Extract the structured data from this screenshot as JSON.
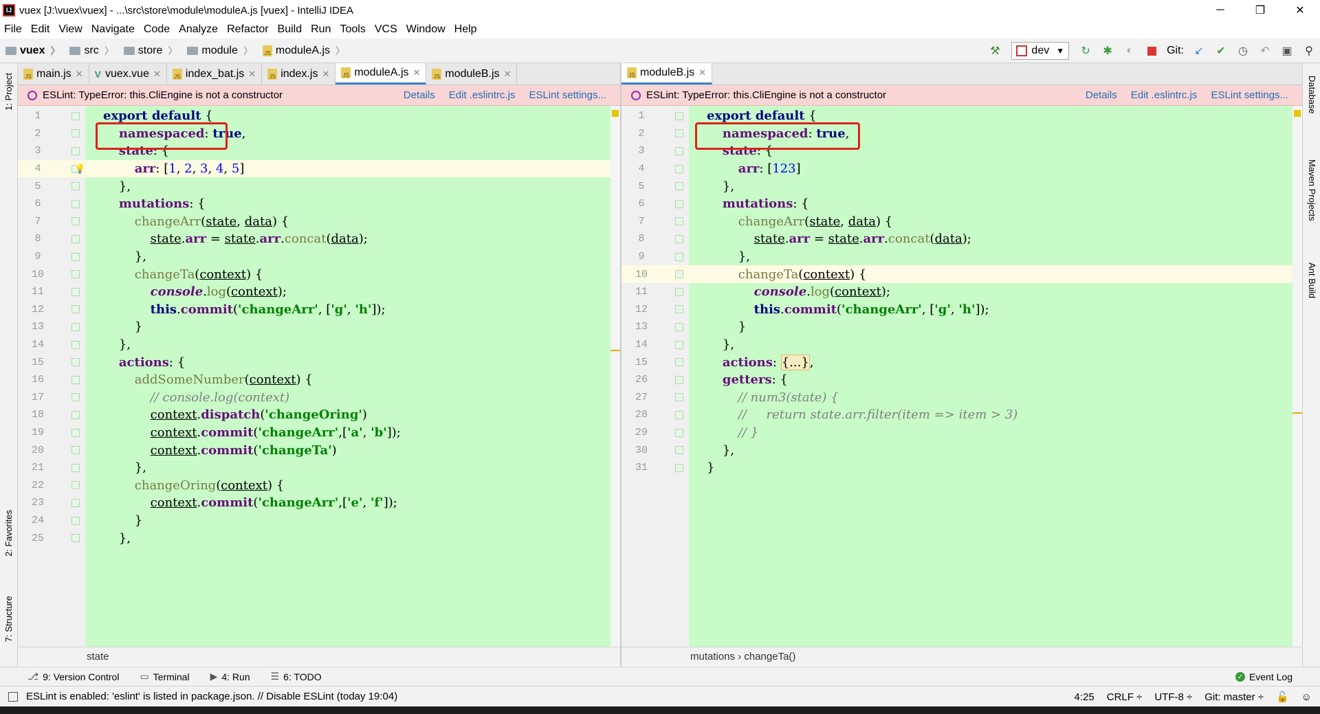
{
  "window": {
    "title": "vuex [J:\\vuex\\vuex] - ...\\src\\store\\module\\moduleA.js [vuex] - IntelliJ IDEA",
    "minimize": "─",
    "restore": "❐",
    "close": "✕"
  },
  "menu": [
    "File",
    "Edit",
    "View",
    "Navigate",
    "Code",
    "Analyze",
    "Refactor",
    "Build",
    "Run",
    "Tools",
    "VCS",
    "Window",
    "Help"
  ],
  "breadcrumbs": [
    "vuex",
    "src",
    "store",
    "module",
    "moduleA.js"
  ],
  "toolbar": {
    "run_config": "dev",
    "git_label": "Git:"
  },
  "left_pane": {
    "tabs": [
      {
        "label": "main.js",
        "type": "js"
      },
      {
        "label": "vuex.vue",
        "type": "vue"
      },
      {
        "label": "index_bat.js",
        "type": "js"
      },
      {
        "label": "index.js",
        "type": "js"
      },
      {
        "label": "moduleA.js",
        "type": "js",
        "active": true
      },
      {
        "label": "moduleB.js",
        "type": "js"
      }
    ],
    "eslint_message": "ESLint: TypeError: this.CliEngine is not a constructor",
    "eslint_links": [
      "Details",
      "Edit .eslintrc.js",
      "ESLint settings..."
    ],
    "lines": [
      {
        "n": "1",
        "html": "<span class='kw'>export default</span> {"
      },
      {
        "n": "2",
        "html": "    <span class='prop'>namespaced</span>: <span class='kw'>true</span>,"
      },
      {
        "n": "3",
        "html": "    <span class='prop'>state</span>: {"
      },
      {
        "n": "4",
        "html": "        <span class='prop'>arr</span>: [<span class='num'>1</span>, <span class='num'>2</span>, <span class='num'>3</span>, <span class='num'>4</span>, <span class='num'>5</span>]",
        "caret": true,
        "bulb": true
      },
      {
        "n": "5",
        "html": "    },"
      },
      {
        "n": "6",
        "html": "    <span class='prop'>mutations</span>: {"
      },
      {
        "n": "7",
        "html": "        <span class='fn'>changeArr</span>(<span class='u'>state</span>, <span class='u'>data</span>) {"
      },
      {
        "n": "8",
        "html": "            <span class='u'>state</span>.<span class='prop'>arr</span> = <span class='u'>state</span>.<span class='prop'>arr</span>.<span class='fn'>concat</span>(<span class='u'>data</span>);"
      },
      {
        "n": "9",
        "html": "        },"
      },
      {
        "n": "10",
        "html": "        <span class='fn'>changeTa</span>(<span class='u'>context</span>) {"
      },
      {
        "n": "11",
        "html": "            <span class='prop' style='font-style:italic'>console</span>.<span class='fn'>log</span>(<span class='u'>context</span>);"
      },
      {
        "n": "12",
        "html": "            <span class='kw'>this</span>.<span class='prop'>commit</span>(<span class='str'>'changeArr'</span>, [<span class='str'>'g'</span>, <span class='str'>'h'</span>]);"
      },
      {
        "n": "13",
        "html": "        }"
      },
      {
        "n": "14",
        "html": "    },"
      },
      {
        "n": "15",
        "html": "    <span class='prop'>actions</span>: {"
      },
      {
        "n": "16",
        "html": "        <span class='fn'>addSomeNumber</span>(<span class='u'>context</span>) {"
      },
      {
        "n": "17",
        "html": "            <span class='cmt'>// console.log(context)</span>"
      },
      {
        "n": "18",
        "html": "            <span class='u'>context</span>.<span class='prop'>dispatch</span>(<span class='str'>'changeOring'</span>)"
      },
      {
        "n": "19",
        "html": "            <span class='u'>context</span>.<span class='prop'>commit</span>(<span class='str'>'changeArr'</span>,[<span class='str'>'a'</span>, <span class='str'>'b'</span>]);"
      },
      {
        "n": "20",
        "html": "            <span class='u'>context</span>.<span class='prop'>commit</span>(<span class='str'>'changeTa'</span>)"
      },
      {
        "n": "21",
        "html": "        },"
      },
      {
        "n": "22",
        "html": "        <span class='fn'>changeOring</span>(<span class='u'>context</span>) {"
      },
      {
        "n": "23",
        "html": "            <span class='u'>context</span>.<span class='prop'>commit</span>(<span class='str'>'changeArr'</span>,[<span class='str'>'e'</span>, <span class='str'>'f'</span>]);"
      },
      {
        "n": "24",
        "html": "        }"
      },
      {
        "n": "25",
        "html": "    },"
      }
    ],
    "status_crumb": "state"
  },
  "right_pane": {
    "tabs": [
      {
        "label": "moduleB.js",
        "type": "js",
        "active": true
      }
    ],
    "eslint_message": "ESLint: TypeError: this.CliEngine is not a constructor",
    "eslint_links": [
      "Details",
      "Edit .eslintrc.js",
      "ESLint settings..."
    ],
    "lines": [
      {
        "n": "1",
        "html": "<span class='kw'>export default</span> {"
      },
      {
        "n": "2",
        "html": "    <span class='prop'>namespaced</span>: <span class='kw'>true</span>,"
      },
      {
        "n": "3",
        "html": "    <span class='prop'>state</span>: {"
      },
      {
        "n": "4",
        "html": "        <span class='prop'>arr</span>: [<span class='num'>123</span>]"
      },
      {
        "n": "5",
        "html": "    },"
      },
      {
        "n": "6",
        "html": "    <span class='prop'>mutations</span>: {"
      },
      {
        "n": "7",
        "html": "        <span class='fn'>changeArr</span>(<span class='u'>state</span>, <span class='u'>data</span>) {"
      },
      {
        "n": "8",
        "html": "            <span class='u'>state</span>.<span class='prop'>arr</span> = <span class='u'>state</span>.<span class='prop'>arr</span>.<span class='fn'>concat</span>(<span class='u'>data</span>);"
      },
      {
        "n": "9",
        "html": "        },"
      },
      {
        "n": "10",
        "html": "        <span class='fn'>changeTa</span>(<span class='u'>context</span>) {",
        "caret": true
      },
      {
        "n": "11",
        "html": "            <span class='prop' style='font-style:italic'>console</span>.<span class='fn'>log</span>(<span class='u'>context</span>);"
      },
      {
        "n": "12",
        "html": "            <span class='kw'>this</span>.<span class='prop'>commit</span>(<span class='str'>'changeArr'</span>, [<span class='str'>'g'</span>, <span class='str'>'h'</span>]);"
      },
      {
        "n": "13",
        "html": "        }"
      },
      {
        "n": "14",
        "html": "    },"
      },
      {
        "n": "15",
        "html": "    <span class='prop'>actions</span>: <span style='background:#f5edc0;border:1px solid #d8c070'>{...}</span>,"
      },
      {
        "n": "26",
        "html": "    <span class='prop'>getters</span>: {"
      },
      {
        "n": "27",
        "html": "        <span class='cmt'>// num3(state) {</span>"
      },
      {
        "n": "28",
        "html": "        <span class='cmt'>//     return state.arr.filter(item => item > 3)</span>"
      },
      {
        "n": "29",
        "html": "        <span class='cmt'>// }</span>"
      },
      {
        "n": "30",
        "html": "    },"
      },
      {
        "n": "31",
        "html": "}"
      }
    ],
    "status_crumb": "mutations  ›  changeTa()"
  },
  "left_tool_windows": [
    "1: Project",
    "2: Favorites",
    "7: Structure"
  ],
  "right_tool_windows": [
    "Database",
    "Maven Projects",
    "Ant Build"
  ],
  "bottom_tools": [
    {
      "icon": "⎇",
      "label": "9: Version Control"
    },
    {
      "icon": "▭",
      "label": "Terminal"
    },
    {
      "icon": "▶",
      "label": "4: Run"
    },
    {
      "icon": "☰",
      "label": "6: TODO"
    }
  ],
  "event_log": "Event Log",
  "status": {
    "message": "ESLint is enabled: 'eslint' is listed in package.json. // Disable ESLint (today 19:04)",
    "position": "4:25",
    "line_sep": "CRLF ÷",
    "encoding": "UTF-8 ÷",
    "git": "Git: master ÷"
  }
}
